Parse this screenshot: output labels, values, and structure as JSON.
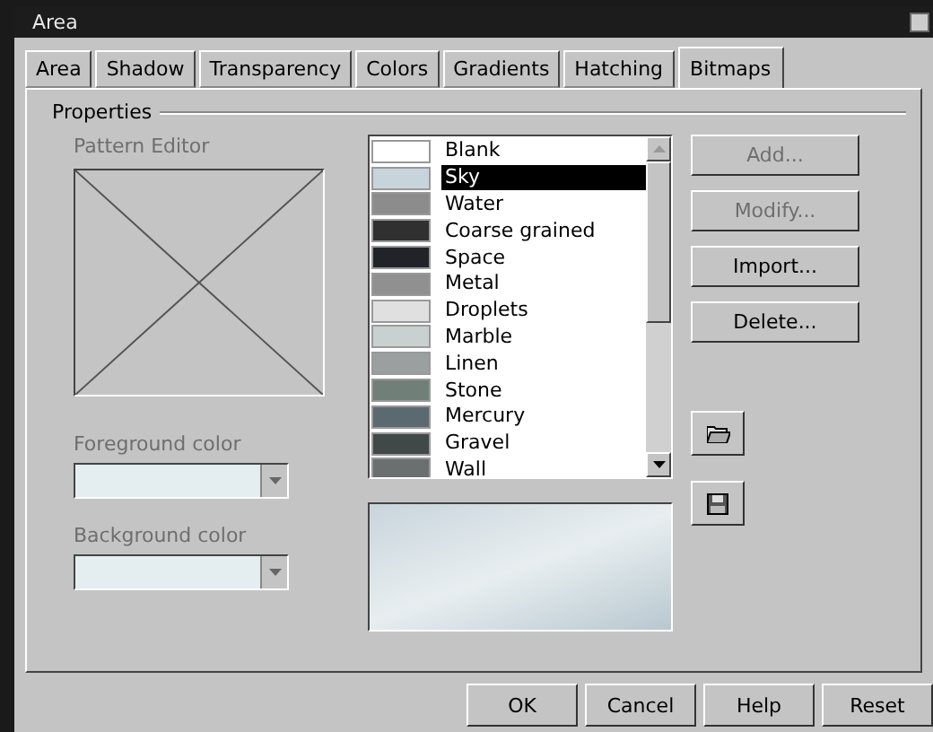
{
  "window": {
    "title": "Area"
  },
  "tabs": [
    {
      "label": "Area",
      "selected": false
    },
    {
      "label": "Shadow",
      "selected": false
    },
    {
      "label": "Transparency",
      "selected": false
    },
    {
      "label": "Colors",
      "selected": false
    },
    {
      "label": "Gradients",
      "selected": false
    },
    {
      "label": "Hatching",
      "selected": false
    },
    {
      "label": "Bitmaps",
      "selected": true
    }
  ],
  "properties": {
    "title": "Properties",
    "pattern_editor": {
      "label": "Pattern Editor",
      "disabled": true
    },
    "foreground": {
      "label": "Foreground color",
      "disabled": true
    },
    "background": {
      "label": "Background color",
      "disabled": true
    }
  },
  "bitmaps": [
    {
      "name": "Blank",
      "color": "#ffffff",
      "selected": false
    },
    {
      "name": "Sky",
      "color": "#c8d4dc",
      "selected": true
    },
    {
      "name": "Water",
      "color": "#8c8c8c",
      "selected": false
    },
    {
      "name": "Coarse grained",
      "color": "#303030",
      "selected": false
    },
    {
      "name": "Space",
      "color": "#202428",
      "selected": false
    },
    {
      "name": "Metal",
      "color": "#909090",
      "selected": false
    },
    {
      "name": "Droplets",
      "color": "#e0e0e0",
      "selected": false
    },
    {
      "name": "Marble",
      "color": "#c8d0d0",
      "selected": false
    },
    {
      "name": "Linen",
      "color": "#9aa0a0",
      "selected": false
    },
    {
      "name": "Stone",
      "color": "#708078",
      "selected": false
    },
    {
      "name": "Mercury",
      "color": "#5a6a70",
      "selected": false
    },
    {
      "name": "Gravel",
      "color": "#404848",
      "selected": false
    },
    {
      "name": "Wall",
      "color": "#6a7070",
      "selected": false
    }
  ],
  "side_buttons": [
    {
      "label": "Add...",
      "disabled": true
    },
    {
      "label": "Modify...",
      "disabled": true
    },
    {
      "label": "Import...",
      "disabled": false
    },
    {
      "label": "Delete...",
      "disabled": false
    }
  ],
  "footer_buttons": [
    "OK",
    "Cancel",
    "Help",
    "Reset"
  ]
}
